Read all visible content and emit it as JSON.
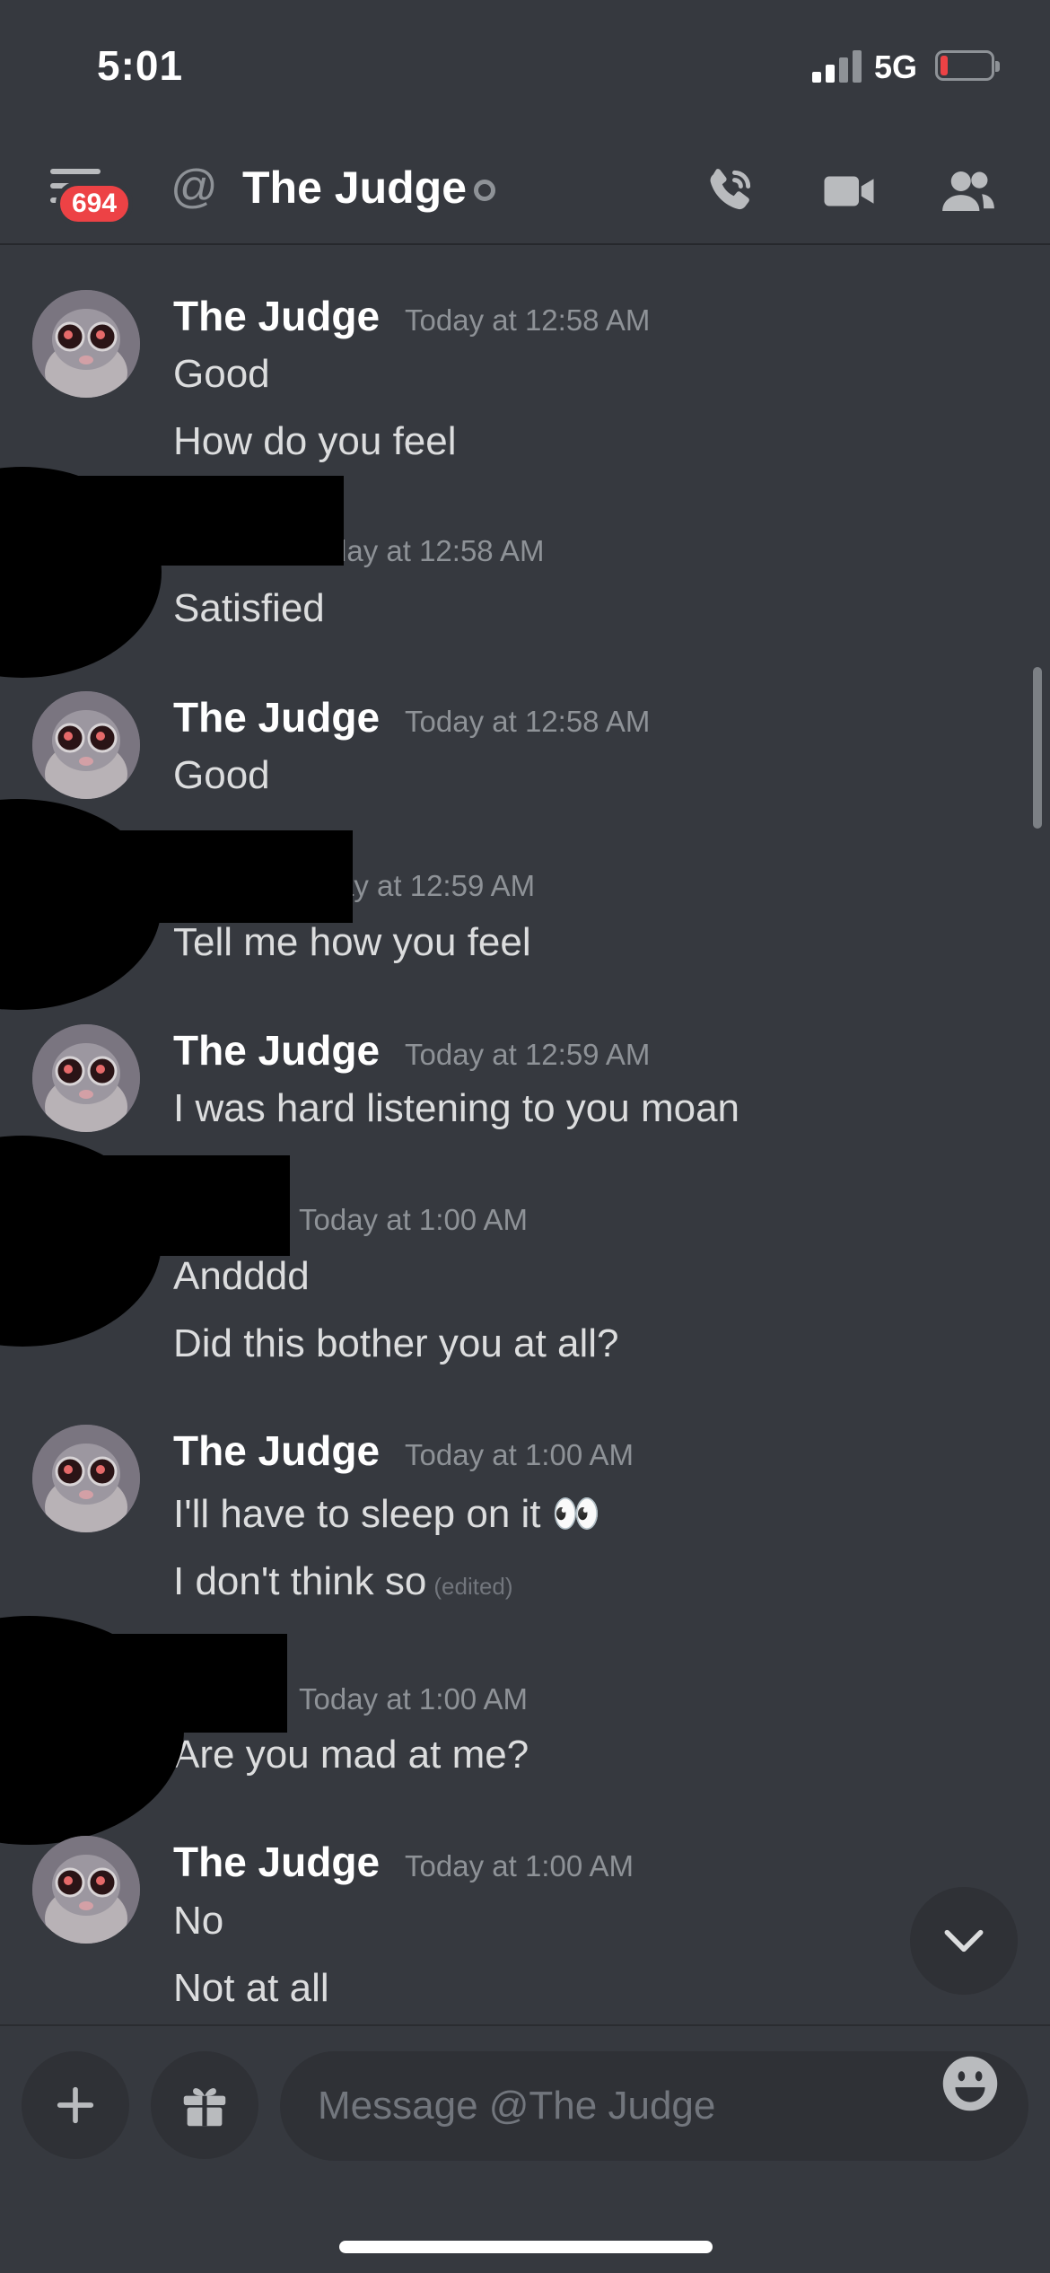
{
  "status_bar": {
    "time": "5:01",
    "network": "5G",
    "battery_level": 0.1
  },
  "header": {
    "unread_badge": "694",
    "title": "The Judge",
    "icons": [
      "menu-icon",
      "at-icon",
      "call-icon",
      "video-icon",
      "members-icon"
    ]
  },
  "messages": [
    {
      "author": "The Judge",
      "timestamp": "Today at 12:58 AM",
      "lines": [
        "Good",
        "How do you feel"
      ]
    },
    {
      "author": "",
      "timestamp": "day at 12:58 AM",
      "lines": [
        "Satisfied"
      ],
      "redacted": true
    },
    {
      "author": "The Judge",
      "timestamp": "Today at 12:58 AM",
      "lines": [
        "Good"
      ]
    },
    {
      "author": "",
      "timestamp": "ay at 12:59 AM",
      "lines": [
        "Tell me how you feel"
      ],
      "redacted": true
    },
    {
      "author": "The Judge",
      "timestamp": "Today at 12:59 AM",
      "lines": [
        "I was hard listening to you moan"
      ]
    },
    {
      "author": "",
      "timestamp": "Today at 1:00 AM",
      "lines": [
        "Andddd",
        "Did this bother you at all?"
      ],
      "redacted": true
    },
    {
      "author": "The Judge",
      "timestamp": "Today at 1:00 AM",
      "lines": [
        "I'll have to sleep on it 👀",
        "I don't think so"
      ],
      "edited_label": "(edited)"
    },
    {
      "author": "",
      "timestamp": "Today at 1:00 AM",
      "lines": [
        "Are you mad at me?"
      ],
      "redacted": true
    },
    {
      "author": "The Judge",
      "timestamp": "Today at 1:00 AM",
      "lines": [
        "No",
        "Not at all"
      ]
    }
  ],
  "composer": {
    "placeholder": "Message @The Judge"
  },
  "colors": {
    "background": "#36393f",
    "input": "#2f3136",
    "badge": "#ed4245",
    "muted": "#8e9297"
  }
}
